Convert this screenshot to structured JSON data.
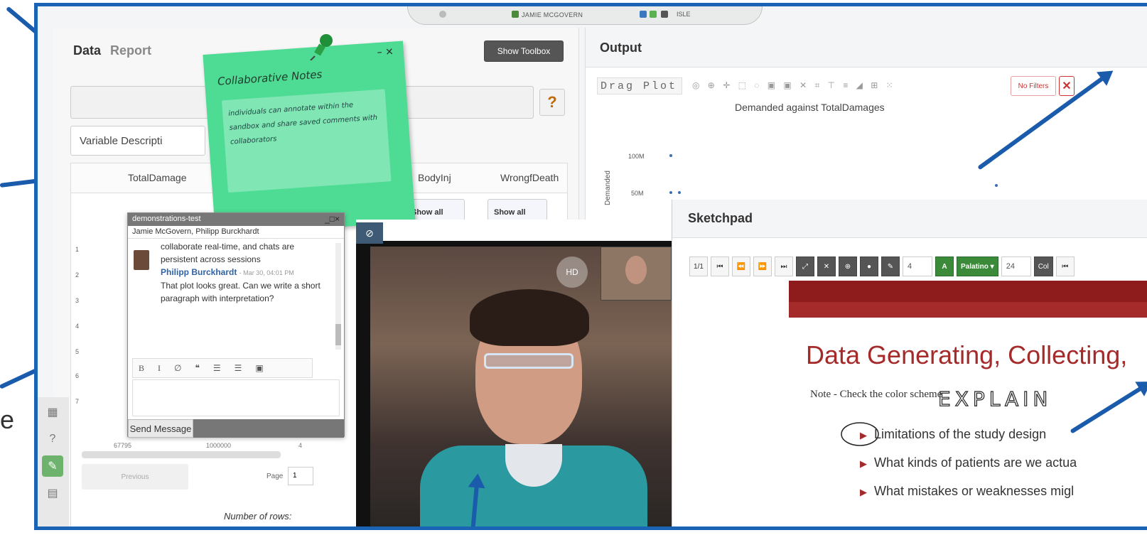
{
  "topbar": {
    "user": "JAMIE MCGOVERN",
    "app": "ISLE"
  },
  "left_panel": {
    "tabs": [
      {
        "label": "Data"
      },
      {
        "label": "Report"
      }
    ],
    "show_toolbox": "Show Toolbox",
    "help": "?",
    "variable_description": "Variable Descripti",
    "columns": [
      "TotalDamage",
      "BodyInj",
      "WrongfDeath"
    ],
    "show_all": "Show all",
    "row_numbers": [
      "1",
      "2",
      "3",
      "4",
      "5",
      "6",
      "7"
    ],
    "bottom_row": {
      "c1": "67795",
      "c2": "1000000",
      "c3": "4"
    },
    "previous": "Previous",
    "page_label": "Page",
    "page_value": "1",
    "number_of_rows": "Number of rows:"
  },
  "sticky_note": {
    "title": "Collaborative Notes",
    "body": "individuals can annotate within the sandbox and share saved comments with collaborators",
    "controls": "– ×"
  },
  "output": {
    "title": "Output",
    "drag_plot": "Drag Plot",
    "no_filters": "No Filters",
    "close_x": "✕",
    "plot_title": "Demanded against TotalDamages",
    "y_label": "Demanded",
    "y_ticks": [
      "100M",
      "50M"
    ]
  },
  "chat": {
    "window_title": "demonstrations-test",
    "controls": "_□×",
    "members": "Jamie McGovern, Philipp Burckhardt",
    "earlier_text": "collaborate real-time, and chats are persistent across sessions",
    "author": "Philipp Burckhardt",
    "timestamp": "- Mar 30, 04:01 PM",
    "message": "That plot looks great. Can we write a short paragraph with interpretation?",
    "editor_tools": "B I ∅ ❝ ☰ ☰ ▣",
    "send": "Send Message"
  },
  "video": {
    "hd": "HD",
    "cam_icon": "camera-off-icon"
  },
  "sketchpad": {
    "title": "Sketchpad",
    "page": "1/1",
    "brush_size": "4",
    "font_label": "A",
    "font_name": "Palatino ▾",
    "font_size": "24",
    "col_label": "Col",
    "slide_heading": "Data Generating, Collecting,",
    "note": "Note - Check the color scheme",
    "bullets": [
      "Limitations of the study design",
      "What kinds of patients are we actua",
      "What mistakes or weaknesses migl"
    ],
    "handwriting": "EXPLAIN"
  },
  "edge_letter": "e",
  "colors": {
    "accent": "#1a5cab",
    "sticky": "#4edb94",
    "slide_red": "#a52a2a"
  }
}
